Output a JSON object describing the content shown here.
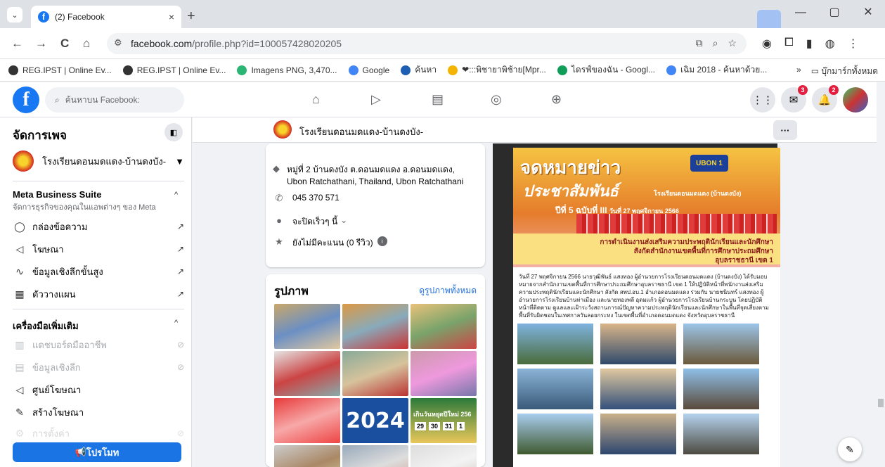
{
  "browser": {
    "tab_title": "(2) Facebook",
    "tab_close": "×",
    "new_tab": "+",
    "window_controls": [
      "—",
      "▢",
      "✕"
    ],
    "url_host": "facebook.com",
    "url_path": "/profile.php?id=100057428020205",
    "nav": {
      "back": "←",
      "forward": "→",
      "reload": "C",
      "home": "⌂"
    },
    "bookmarks": [
      {
        "label": "REG.IPST | Online Ev...",
        "color": "#333"
      },
      {
        "label": "REG.IPST | Online Ev...",
        "color": "#333"
      },
      {
        "label": "Imagens PNG, 3,470...",
        "color": "#2bb673"
      },
      {
        "label": "Google",
        "color": "#4285f4"
      },
      {
        "label": "ค้นหา",
        "color": "#1e5fb3"
      },
      {
        "label": "❤:::พิชายาพิช้าย[Mpr...",
        "color": "#f4b400"
      },
      {
        "label": "ไดรฟ์ของฉัน - Googl...",
        "color": "#0f9d58"
      },
      {
        "label": "เฉิม 2018 - ค้นหาด้วย...",
        "color": "#4285f4"
      }
    ],
    "bookmarks_overflow": "»",
    "bookmarks_all": "บุ๊กมาร์กทั้งหมด"
  },
  "fb": {
    "logo": "f",
    "search_placeholder": "ค้นหาบน Facebook:",
    "badges": {
      "messenger": "3",
      "notifications": "2"
    }
  },
  "sidebar": {
    "title": "จัดการเพจ",
    "page_name": "โรงเรียนดอนมดแดง-บ้านดงบัง-",
    "mbs_title": "Meta Business Suite",
    "mbs_sub": "จัดการธุรกิจของคุณในแอพต่างๆ ของ Meta",
    "mbs_items": [
      {
        "icon": "inbox-icon",
        "glyph": "◯",
        "label": "กล่องข้อความ"
      },
      {
        "icon": "ads-icon",
        "glyph": "◁",
        "label": "โฆษณา"
      },
      {
        "icon": "insights-icon",
        "glyph": "∿",
        "label": "ข้อมูลเชิงลึกขั้นสูง"
      },
      {
        "icon": "planner-icon",
        "glyph": "▦",
        "label": "ตัววางแผน"
      }
    ],
    "tools_title": "เครื่องมือเพิ่มเติม",
    "tools_items": [
      {
        "icon": "dashboard-icon",
        "glyph": "▥",
        "label": "แดชบอร์ดมืออาชีพ",
        "dim": true
      },
      {
        "icon": "insight-icon",
        "glyph": "▤",
        "label": "ข้อมูลเชิงลึก",
        "dim": true
      },
      {
        "icon": "ad-center-icon",
        "glyph": "◁",
        "label": "ศูนย์โฆษณา",
        "dim": false
      },
      {
        "icon": "create-ad-icon",
        "glyph": "✎",
        "label": "สร้างโฆษณา",
        "dim": false
      },
      {
        "icon": "settings-icon",
        "glyph": "⚙",
        "label": "การตั้งค่า",
        "dim": true
      }
    ],
    "promote": "โปรโมท"
  },
  "page_header": {
    "name": "โรงเรียนดอนมดแดง-บ้านดงบัง-",
    "more": "···"
  },
  "intro": {
    "address": "หมู่ที่ 2 บ้านดงบัง ต.ดอนมดแดง อ.ดอนมดแดง, Ubon Ratchathani, Thailand, Ubon Ratchathani",
    "phone": "045 370 571",
    "hours": "จะปิดเร็วๆ นี้",
    "rating": "ยังไม่มีคะแนน (0 รีวิว)"
  },
  "photos": {
    "title": "รูปภาพ",
    "see_all": "ดูรูปภาพทั้งหมด",
    "year_tile": "2024",
    "holiday_tile": "เกินวันหยุดปีใหม่ 256",
    "dates": [
      "29",
      "30",
      "31",
      "1"
    ]
  },
  "post": {
    "title": "จดหมายข่าว",
    "subtitle": "ประชาสัมพันธ์",
    "school": "โรงเรียนดอนมดแดง (บ้านดงบัง)",
    "ubon": "UBON 1",
    "issue": "ปีที่ 5 ฉบับที่ III",
    "date": "วันที่ 27 พฤศจิกายน 2566",
    "band1": "การดำเนินงานส่งเสริมความประพฤตินักเรียนและนักศึกษา",
    "band2": "สังกัดสำนักงานเขตพื้นที่การศึกษาประถมศึกษา",
    "band3": "อุบลราชธานี เขต 1",
    "body": "วันที่ 27 พฤศจิกายน 2566 นายวุฒิพันธ์ แสงทอง ผู้อำนวยการโรงเรียนดอนมดแดง (บ้านดงบัง) ได้รับมอบหมายจากสำนักงานเขตพื้นที่การศึกษาประถมศึกษาอุบลราชธานี เขต 1 ให้ปฏิบัติหน้าที่พนักงานส่งเสริมความประพฤตินักเรียนและนักศึกษา สังกัด สพป.อบ.1 อำเภอดอนมดแดง ร่วมกับ นายชนินทร์ แสงทอง ผู้อำนวยการโรงเรียนบ้านท่าเมือง และนายทองพลี อุดมแก้ว ผู้อำนวยการโรงเรียนบ้านกระบูน โดยปฏิบัติหน้าที่ติดตาม ดูแลและเฝ้าระวังสถานการณ์ปัญหาความประพฤตินักเรียนและนักศึกษาในพื้นที่จุดเสี่ยงตามพื้นที่รับผิดชอบในเทศกาลวันลอยกระทง ในเขตพื้นที่อำเภอดอนมดแดง จังหวัดอุบลราชธานี"
  },
  "colors": {
    "fb_blue": "#1877f2",
    "promote_blue": "#1b74e4",
    "link": "#216fdb"
  }
}
